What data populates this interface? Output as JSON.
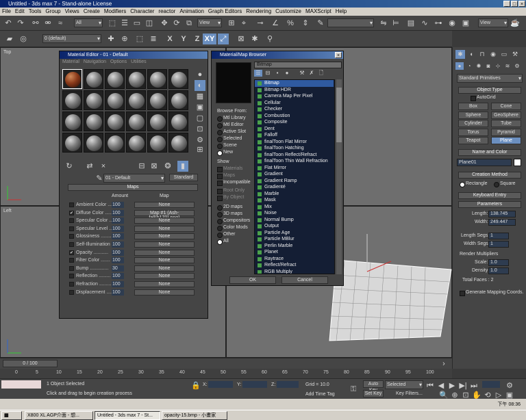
{
  "window": {
    "title": "Untitled - 3ds max 7 - Stand-alone License"
  },
  "menu": [
    "File",
    "Edit",
    "Tools",
    "Group",
    "Views",
    "Create",
    "Modifiers",
    "Character",
    "reactor",
    "Animation",
    "Graph Editors",
    "Rendering",
    "Customize",
    "MAXScript",
    "Help"
  ],
  "toolbar": {
    "selection_filter": "All",
    "ref_coord": "View",
    "ref_coord2": "View",
    "axis_x": "X",
    "axis_y": "Y",
    "axis_z": "Z",
    "axis_xy": "XY",
    "layer": "0 (default)"
  },
  "viewports": {
    "top": "Top",
    "left": "Left"
  },
  "material_editor": {
    "title": "Material Editor - 01 - Default",
    "menu": [
      "Material",
      "Navigation",
      "Options",
      "Utilities"
    ],
    "material_name": "01 - Default",
    "material_type": "Standard",
    "rollout": "Maps",
    "col_amount": "Amount",
    "col_map": "Map",
    "maps": [
      {
        "name": "Ambient Color ......",
        "amount": "100",
        "map": "None",
        "checked": false
      },
      {
        "name": "Diffuse Color ......",
        "amount": "100",
        "map": "Map #1 (Ash-fall(h170).png)",
        "checked": true
      },
      {
        "name": "Specular Color .....",
        "amount": "100",
        "map": "None",
        "checked": false
      },
      {
        "name": "Specular Level .....",
        "amount": "100",
        "map": "None",
        "checked": false
      },
      {
        "name": "Glossiness ........",
        "amount": "100",
        "map": "None",
        "checked": false
      },
      {
        "name": "Self-Illumination ...",
        "amount": "100",
        "map": "None",
        "checked": false
      },
      {
        "name": "Opacity ...........",
        "amount": "100",
        "map": "None",
        "checked": true
      },
      {
        "name": "Filter Color .......",
        "amount": "100",
        "map": "None",
        "checked": false
      },
      {
        "name": "Bump ..............",
        "amount": "30",
        "map": "None",
        "checked": false
      },
      {
        "name": "Reflection .........",
        "amount": "100",
        "map": "None",
        "checked": false
      },
      {
        "name": "Refraction .........",
        "amount": "100",
        "map": "None",
        "checked": false
      },
      {
        "name": "Displacement .......",
        "amount": "100",
        "map": "None",
        "checked": false
      }
    ]
  },
  "browser": {
    "title": "Material/Map Browser",
    "field": "Bitmap",
    "browse_from_label": "Browse From:",
    "browse_from": [
      "Mtl Library",
      "Mtl Editor",
      "Active Slot",
      "Selected",
      "Scene",
      "New"
    ],
    "browse_selected": "New",
    "show_label": "Show",
    "show": [
      "Materials",
      "Maps",
      "Incompatible"
    ],
    "filter_options": [
      "Root Only",
      "By Object"
    ],
    "map_types": [
      "2D maps",
      "3D maps",
      "Compositors",
      "Color Mods",
      "Other",
      "All"
    ],
    "map_type_selected": "All",
    "items": [
      "Bitmap",
      "Bitmap HDR",
      "Camera Map Per Pixel",
      "Cellular",
      "Checker",
      "Combustion",
      "Composite",
      "Dent",
      "Falloff",
      "finalToon Flat Mirror",
      "finalToon Hatching",
      "finalToon Reflect/Refract",
      "finalToon Thin Wall Refraction",
      "Flat Mirror",
      "Gradient",
      "Gradient Ramp",
      "Gradienté",
      "Marble",
      "Mask",
      "Mix",
      "Noise",
      "Normal Bump",
      "Output",
      "Particle Age",
      "Particle MBlur",
      "Perlin Marble",
      "Planet",
      "Raytrace",
      "Reflect/Refract",
      "RGB Multiply"
    ],
    "selected_item": "Bitmap",
    "ok": "OK",
    "cancel": "Cancel"
  },
  "cmd_panel": {
    "category": "Standard Primitives",
    "object_type": "Object Type",
    "autogrid": "AutoGrid",
    "prims": [
      "Box",
      "Cone",
      "Sphere",
      "GeoSphere",
      "Cylinder",
      "Tube",
      "Torus",
      "Pyramid",
      "Teapot",
      "Plane"
    ],
    "active_prim": "Plane",
    "name_color": "Name and Color",
    "object_name": "Plane01",
    "creation_method": "Creation Method",
    "method_rect": "Rectangle",
    "method_square": "Square",
    "keyboard_entry": "Keyboard Entry",
    "parameters": "Parameters",
    "length_label": "Length:",
    "length": "138.745",
    "width_label": "Width:",
    "width": "249.447",
    "length_segs_label": "Length Segs:",
    "length_segs": "1",
    "width_segs_label": "Width Segs:",
    "width_segs": "1",
    "render_mult": "Render Multipliers",
    "scale_label": "Scale:",
    "scale": "1.0",
    "density_label": "Density:",
    "density": "1.0",
    "total_faces": "Total Faces : 2",
    "gen_coords": "Generate Mapping Coords."
  },
  "timeline": {
    "frame": "0 / 100",
    "ticks": [
      "0",
      "5",
      "10",
      "15",
      "20",
      "25",
      "30",
      "35",
      "40",
      "45",
      "50",
      "55",
      "60",
      "65",
      "70",
      "75",
      "80",
      "85",
      "90",
      "95",
      "100"
    ]
  },
  "status": {
    "selected": "1 Object Selected",
    "prompt": "Click and drag to begin creation process",
    "x_label": "X:",
    "y_label": "Y:",
    "z_label": "Z:",
    "grid": "Grid = 10.0",
    "add_time_tag": "Add Time Tag",
    "auto_key": "Auto Key",
    "set_key": "Set Key",
    "selected_dd": "Selected",
    "key_filters": "Key Filters..."
  },
  "taskbar": {
    "tasks": [
      "X800 XL AGP介面 - 想...",
      "Untitled - 3ds max 7 - St...",
      "opacity-15.bmp - 小畫家"
    ],
    "clock": "下午 08:36"
  }
}
